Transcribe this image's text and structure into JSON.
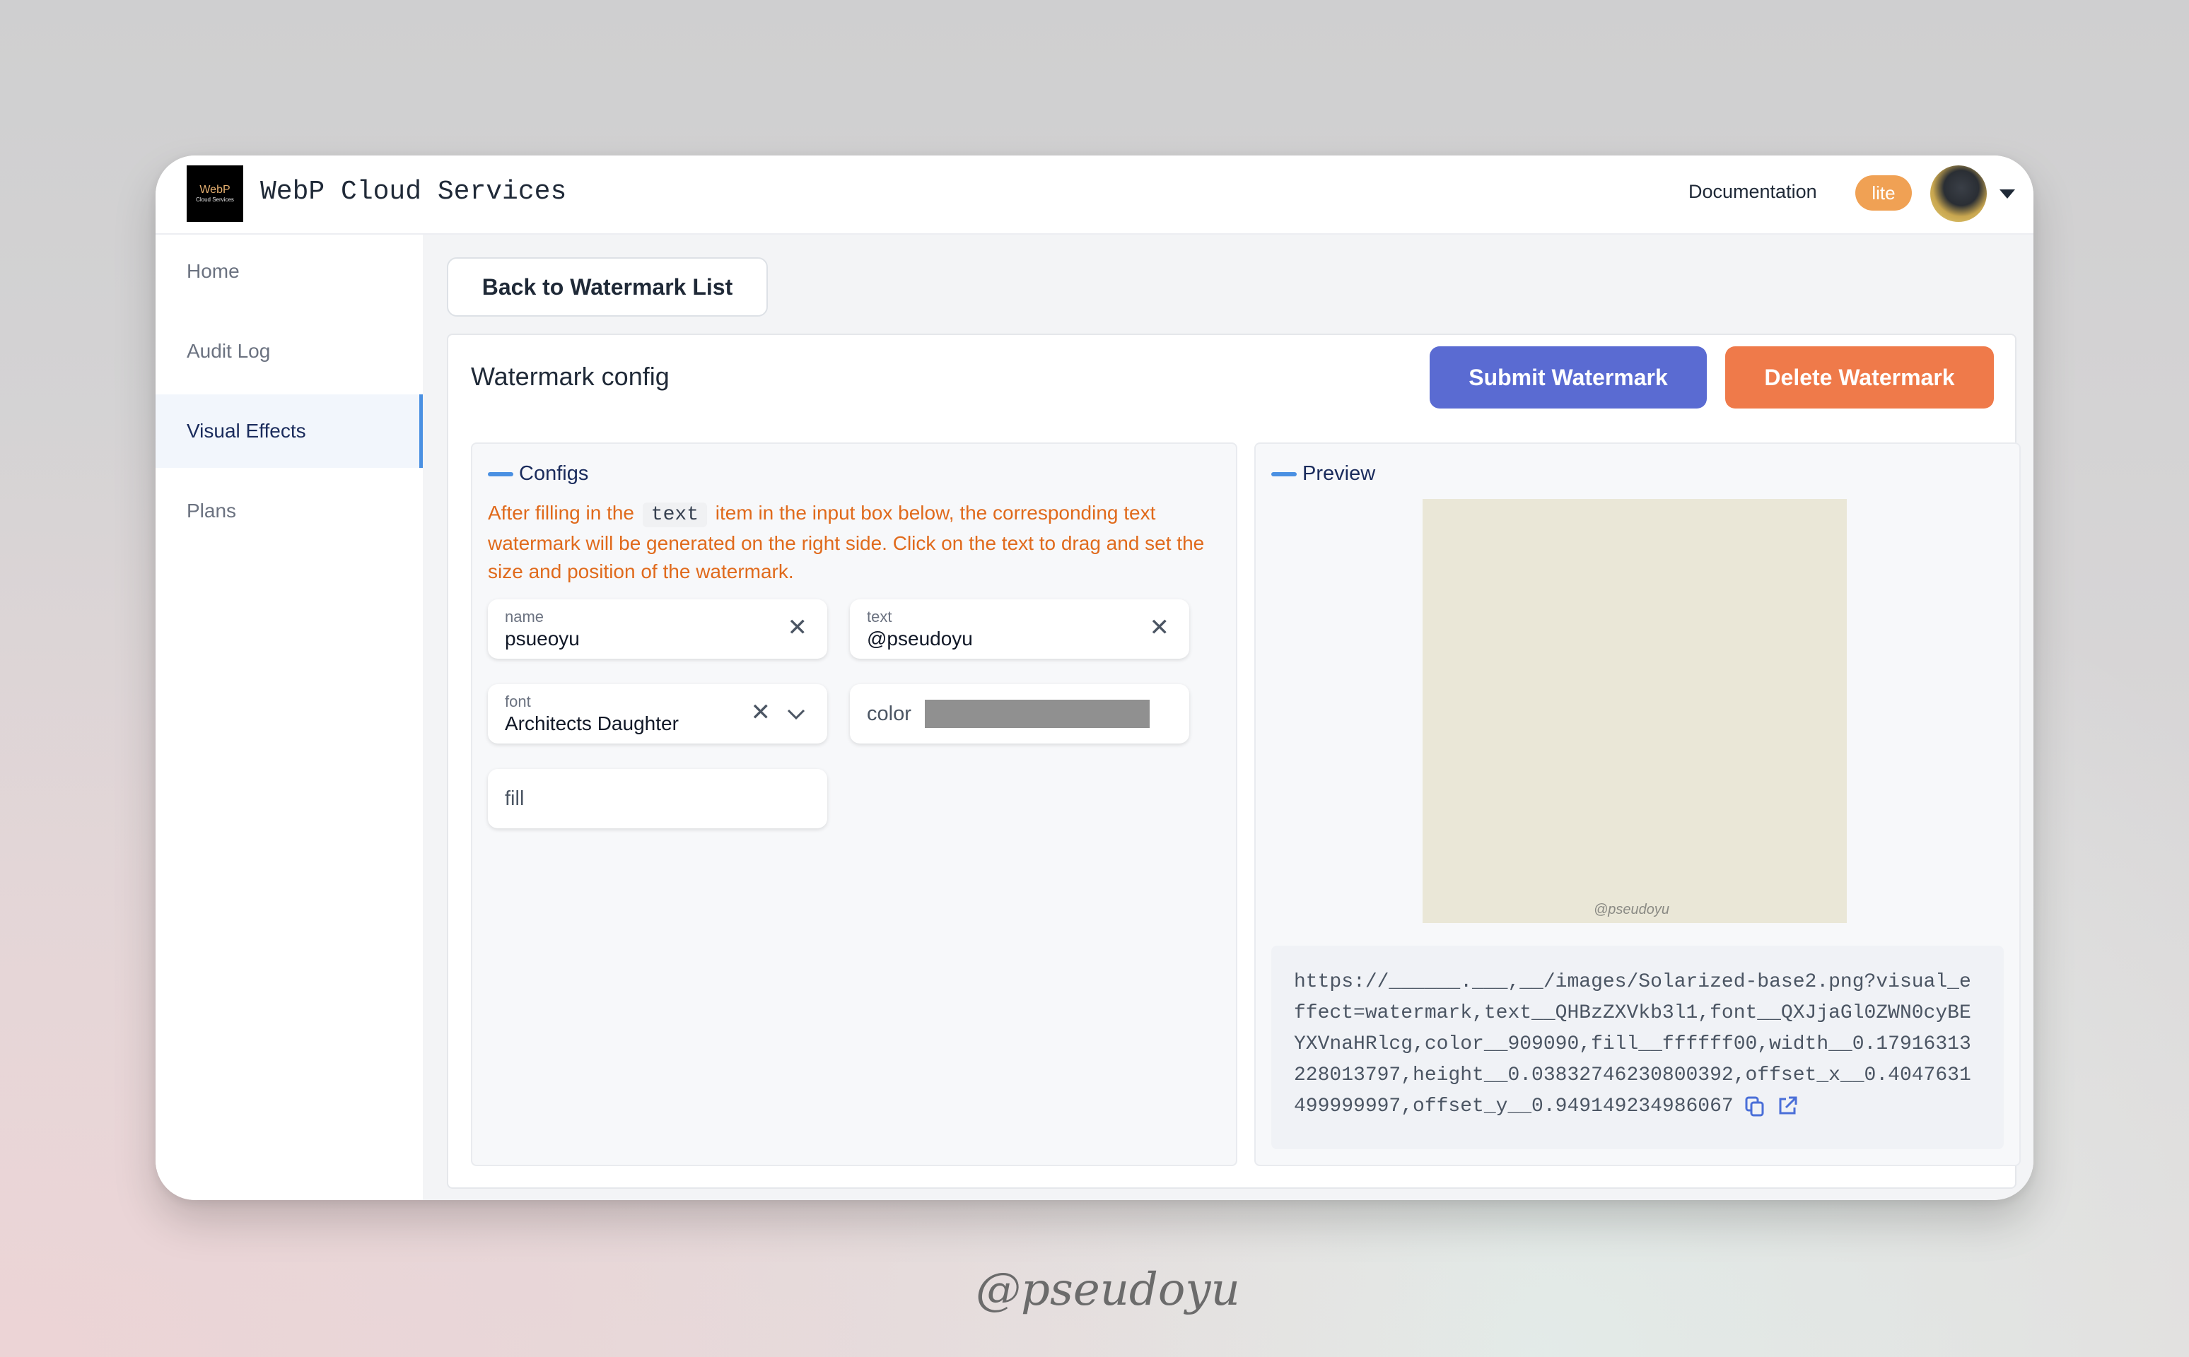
{
  "header": {
    "logo_line1": "WebP",
    "logo_line2": "Cloud Services",
    "app_title": "WebP Cloud Services",
    "documentation_label": "Documentation",
    "plan_badge": "lite"
  },
  "sidebar": {
    "items": [
      {
        "label": "Home"
      },
      {
        "label": "Audit Log"
      },
      {
        "label": "Visual Effects"
      },
      {
        "label": "Plans"
      }
    ],
    "active": "Visual Effects"
  },
  "main": {
    "back_button_label": "Back to Watermark List",
    "card_title": "Watermark config",
    "submit_label": "Submit Watermark",
    "delete_label": "Delete Watermark"
  },
  "configs": {
    "label": "Configs",
    "hint_before": "After filling in the",
    "hint_code": "text",
    "hint_after": "item in the input box below, the corresponding text watermark will be generated on the right side. Click on the text to drag and set the size and position of the watermark.",
    "name_field": {
      "label": "name",
      "value": "psueoyu"
    },
    "text_field": {
      "label": "text",
      "value": "@pseudoyu"
    },
    "font_field": {
      "label": "font",
      "value": "Architects Daughter"
    },
    "color_field": {
      "label": "color",
      "value": "#909090"
    },
    "fill_field": {
      "placeholder": "fill"
    }
  },
  "preview": {
    "label": "Preview",
    "image_background": "#eae7d7",
    "watermark_text": "@pseudoyu",
    "url": "https://______.___,__/images/Solarized-base2.png?visual_effect=watermark,text__QHBzZXVkb3l1,font__QXJjaGl0ZWN0cyBEYXVnaHRlcg,color__909090,fill__ffffff00,width__0.17916313228013797,height__0.03832746230800392,offset_x__0.4047631499999997,offset_y__0.949149234986067"
  },
  "signature": "@pseudoyu",
  "colors": {
    "submit": "#5a6bd2",
    "delete": "#ef7a4a",
    "accent": "#4a90e2",
    "hint": "#e06a1c",
    "badge": "#f0a154"
  }
}
